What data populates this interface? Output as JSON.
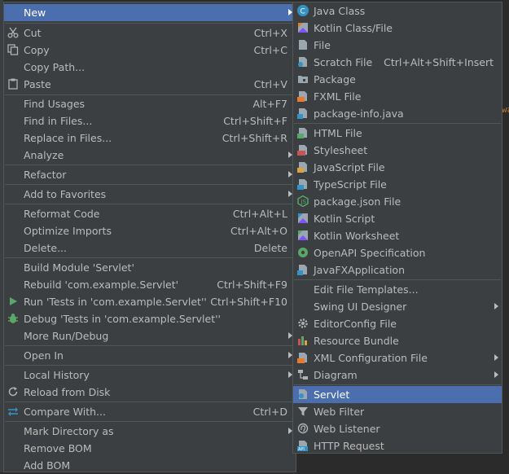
{
  "menu_main": {
    "items": [
      {
        "label": "New",
        "shortcut": "",
        "submenu": true,
        "selected": true,
        "icon": "none"
      },
      {
        "label": "Cut",
        "shortcut": "Ctrl+X",
        "icon": "scissors-icon"
      },
      {
        "label": "Copy",
        "shortcut": "Ctrl+C",
        "icon": "copy-icon"
      },
      {
        "label": "Copy Path...",
        "shortcut": "",
        "icon": "none"
      },
      {
        "label": "Paste",
        "shortcut": "Ctrl+V",
        "icon": "paste-icon"
      },
      {
        "label": "Find Usages",
        "shortcut": "Alt+F7"
      },
      {
        "label": "Find in Files...",
        "shortcut": "Ctrl+Shift+F"
      },
      {
        "label": "Replace in Files...",
        "shortcut": "Ctrl+Shift+R"
      },
      {
        "label": "Analyze",
        "shortcut": "",
        "submenu": true
      },
      {
        "label": "Refactor",
        "shortcut": "",
        "submenu": true
      },
      {
        "label": "Add to Favorites",
        "shortcut": "",
        "submenu": true
      },
      {
        "label": "Reformat Code",
        "shortcut": "Ctrl+Alt+L"
      },
      {
        "label": "Optimize Imports",
        "shortcut": "Ctrl+Alt+O"
      },
      {
        "label": "Delete...",
        "shortcut": "Delete"
      },
      {
        "label": "Build Module 'Servlet'",
        "shortcut": ""
      },
      {
        "label": "Rebuild 'com.example.Servlet'",
        "shortcut": "Ctrl+Shift+F9"
      },
      {
        "label": "Run 'Tests in 'com.example.Servlet''",
        "shortcut": "Ctrl+Shift+F10",
        "icon": "run-icon"
      },
      {
        "label": "Debug 'Tests in 'com.example.Servlet''",
        "shortcut": "",
        "icon": "debug-icon"
      },
      {
        "label": "More Run/Debug",
        "shortcut": "",
        "submenu": true
      },
      {
        "label": "Open In",
        "shortcut": "",
        "submenu": true
      },
      {
        "label": "Local History",
        "shortcut": "",
        "submenu": true
      },
      {
        "label": "Reload from Disk",
        "shortcut": "",
        "icon": "reload-icon"
      },
      {
        "label": "Compare With...",
        "shortcut": "Ctrl+D",
        "icon": "compare-icon"
      },
      {
        "label": "Mark Directory as",
        "shortcut": "",
        "submenu": true
      },
      {
        "label": "Remove BOM",
        "shortcut": ""
      },
      {
        "label": "Add BOM",
        "shortcut": ""
      }
    ]
  },
  "menu_new": {
    "items": [
      {
        "label": "Java Class",
        "icon": "java-class-icon"
      },
      {
        "label": "Kotlin Class/File",
        "icon": "kotlin-class-icon"
      },
      {
        "label": "File",
        "icon": "file-icon"
      },
      {
        "label": "Scratch File",
        "shortcut": "Ctrl+Alt+Shift+Insert",
        "icon": "scratch-file-icon"
      },
      {
        "label": "Package",
        "icon": "package-icon"
      },
      {
        "label": "FXML File",
        "icon": "fxml-file-icon"
      },
      {
        "label": "package-info.java",
        "icon": "java-file-icon"
      },
      {
        "label": "HTML File",
        "icon": "html-file-icon"
      },
      {
        "label": "Stylesheet",
        "icon": "css-file-icon"
      },
      {
        "label": "JavaScript File",
        "icon": "js-file-icon"
      },
      {
        "label": "TypeScript File",
        "icon": "ts-file-icon"
      },
      {
        "label": "package.json File",
        "icon": "nodejs-icon"
      },
      {
        "label": "Kotlin Script",
        "icon": "kotlin-script-icon"
      },
      {
        "label": "Kotlin Worksheet",
        "icon": "kotlin-worksheet-icon"
      },
      {
        "label": "OpenAPI Specification",
        "icon": "openapi-icon"
      },
      {
        "label": "JavaFXApplication",
        "icon": "java-file-icon"
      },
      {
        "label": "Edit File Templates..."
      },
      {
        "label": "Swing UI Designer",
        "submenu": true
      },
      {
        "label": "EditorConfig File",
        "icon": "gear-icon"
      },
      {
        "label": "Resource Bundle",
        "icon": "resource-bundle-icon"
      },
      {
        "label": "XML Configuration File",
        "submenu": true,
        "icon": "xml-file-icon"
      },
      {
        "label": "Diagram",
        "submenu": true,
        "icon": "diagram-icon"
      },
      {
        "label": "Servlet",
        "selected": true,
        "icon": "servlet-icon"
      },
      {
        "label": "Web Filter",
        "icon": "filter-icon"
      },
      {
        "label": "Web Listener",
        "icon": "listener-icon"
      },
      {
        "label": "HTTP Request",
        "icon": "api-icon"
      }
    ]
  },
  "colors": {
    "menu_bg": "#3c3f41",
    "selection": "#4b6eaf",
    "separator": "#515658",
    "text": "#bbbbbb"
  }
}
